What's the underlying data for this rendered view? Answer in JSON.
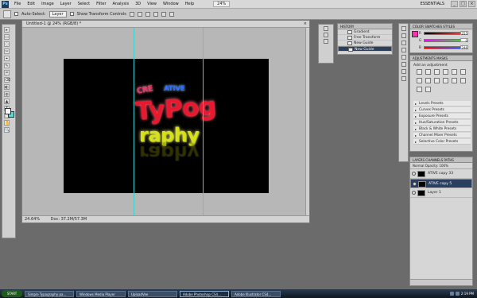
{
  "menubar": {
    "logo": "Ps",
    "items": [
      "File",
      "Edit",
      "Image",
      "Layer",
      "Select",
      "Filter",
      "Analysis",
      "3D",
      "View",
      "Window",
      "Help"
    ],
    "zoom": "24%",
    "workspace": "ESSENTIALS",
    "win_controls": [
      "_",
      "□",
      "×"
    ]
  },
  "options_bar": {
    "auto_select_label": "Auto-Select:",
    "auto_select_value": "Layer",
    "show_transform_label": "Show Transform Controls"
  },
  "document": {
    "title": "Untitled-1 @ 24% (RGB/8) *",
    "close": "×",
    "zoom_status": "24.64%",
    "doc_status": "Doc: 37.2M/57.3M"
  },
  "artwork": {
    "line1a": "CRE",
    "line1b": "ATIVE",
    "line2": "TyPog",
    "line3": "raphy",
    "line3_reflection": "raphy"
  },
  "history_panel": {
    "tabs": "HISTORY",
    "rows": [
      "Gradient",
      "Free Transform",
      "New Guide",
      "New Guide"
    ]
  },
  "color_panel": {
    "tabs": "COLOR   SWATCHES   STYLES",
    "rows": [
      {
        "label": "R",
        "value": "255"
      },
      {
        "label": "G",
        "value": "0"
      },
      {
        "label": "B",
        "value": "246"
      }
    ],
    "colors": {
      "red_bar": "#ff3a3a",
      "green_bar": "#39d639",
      "blue_bar": "#3a5bff",
      "current": "#ff2fb0"
    }
  },
  "adjustments_panel": {
    "tabs": "ADJUSTMENTS   MASKS",
    "title": "Add an adjustment",
    "presets": [
      "Levels Presets",
      "Curves Presets",
      "Exposure Presets",
      "Hue/Saturation Presets",
      "Black & White Presets",
      "Channel Mixer Presets",
      "Selective Color Presets"
    ]
  },
  "layers_panel": {
    "tabs": "LAYERS   CHANNELS   PATHS",
    "opts": "Normal   Opacity: 100%",
    "rows": [
      "ATIVE copy 33",
      "ATIVE copy 5",
      "Layer 1"
    ]
  },
  "taskbar": {
    "start": "START",
    "tasks": [
      "Simple Typography pa...",
      "Windows Media Player",
      "UploadVee",
      "Adobe Photoshop CS4...",
      "Adobe Illustrator CS4..."
    ],
    "clock": "2:19 PM"
  },
  "tools": [
    "▸",
    "▭",
    "◌",
    "✂",
    "⌖",
    "✎",
    "♒",
    "⌫",
    "◐",
    "◍",
    "▲",
    "T",
    "⬚",
    "✋",
    "🔍"
  ]
}
